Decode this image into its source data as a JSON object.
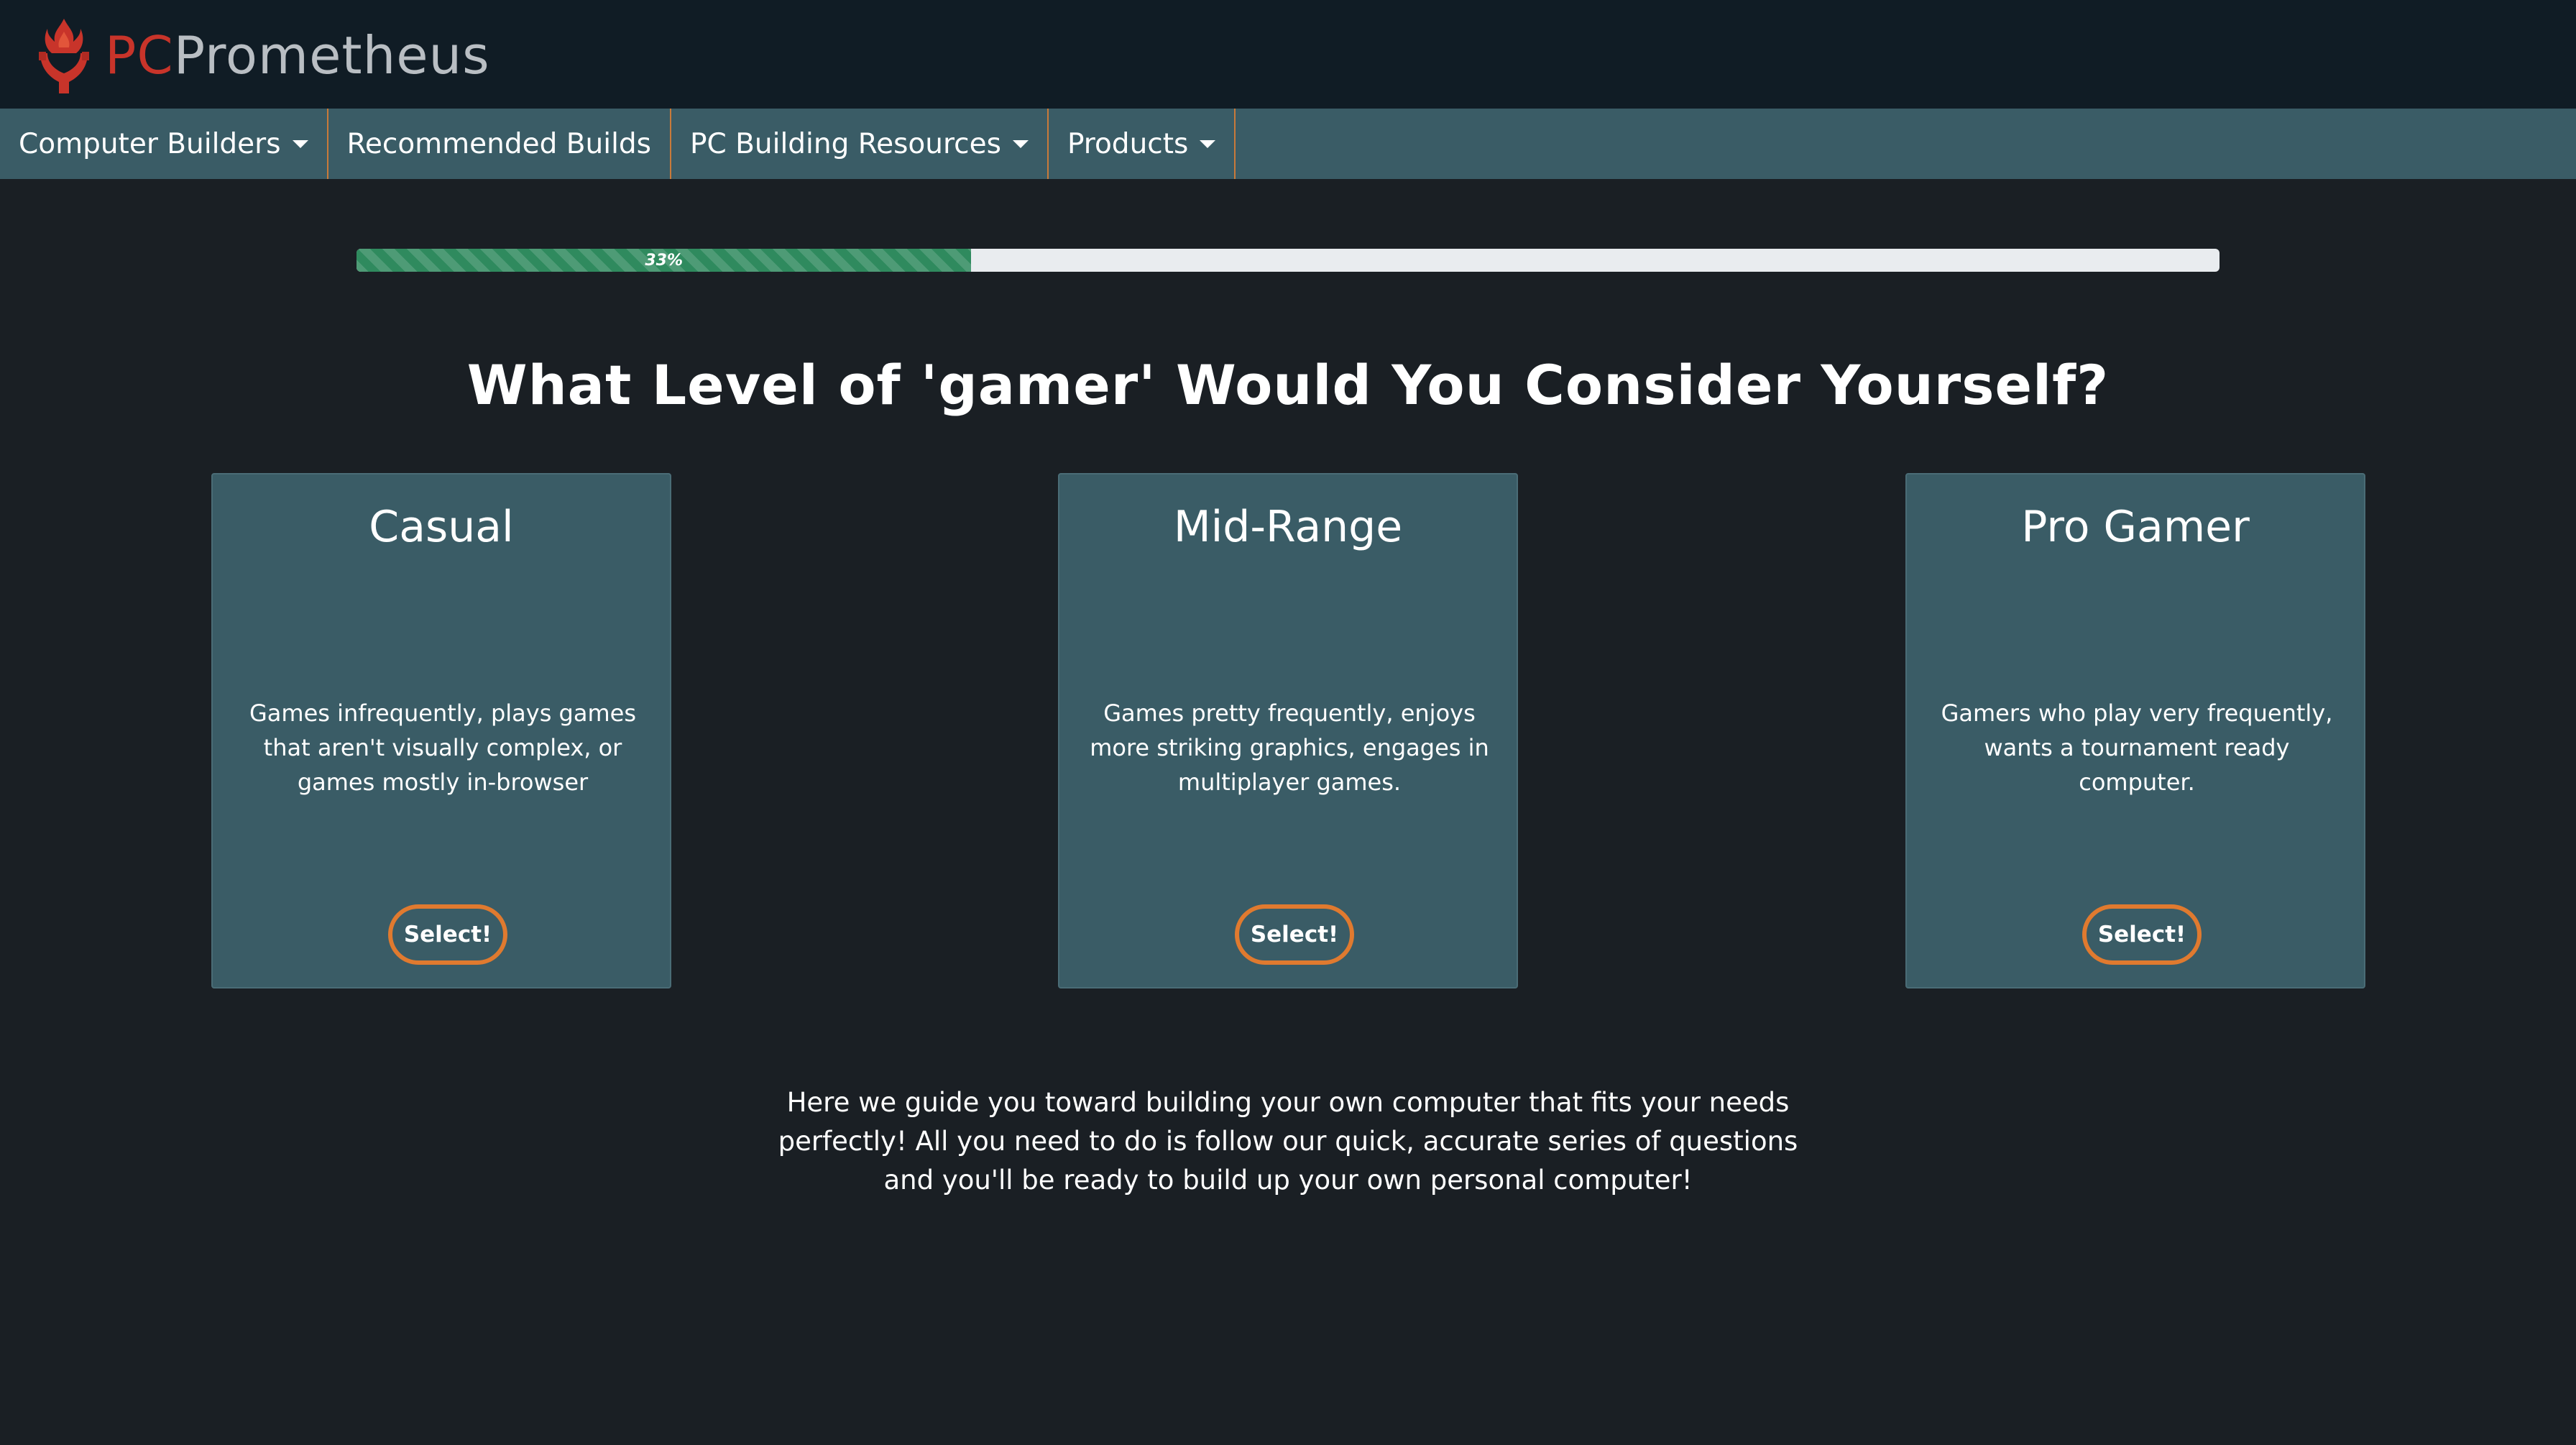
{
  "header": {
    "logo_pc": "PC",
    "logo_name": "Prometheus",
    "logo_icon": "flame-hands-icon"
  },
  "nav": {
    "items": [
      {
        "label": "Computer Builders",
        "has_dropdown": true
      },
      {
        "label": "Recommended Builds",
        "has_dropdown": false
      },
      {
        "label": "PC Building Resources",
        "has_dropdown": true
      },
      {
        "label": "Products",
        "has_dropdown": true
      }
    ]
  },
  "progress": {
    "value": 0.33,
    "label": "33%"
  },
  "question": {
    "title": "What Level of 'gamer' Would You Consider Yourself?"
  },
  "options": [
    {
      "title": "Casual",
      "description": "Games infrequently, plays games that aren't visually complex, or games mostly in-browser",
      "button": "Select!"
    },
    {
      "title": "Mid-Range",
      "description": "Games pretty frequently, enjoys more striking graphics, engages in multiplayer games.",
      "button": "Select!"
    },
    {
      "title": "Pro Gamer",
      "description": "Gamers who play very frequently, wants a tournament ready computer.",
      "button": "Select!"
    }
  ],
  "intro": {
    "text": "Here we guide you toward building your own computer that fits your needs perfectly! All you need to do is follow our quick, accurate series of questions and you'll be ready to build up your own personal computer!"
  },
  "colors": {
    "header_bg": "#101c25",
    "nav_bg": "#3a5c66",
    "page_bg": "#1a1f24",
    "card_bg": "#3a5c66",
    "accent": "#e07a2f",
    "progress_fill": "#2f8a5e",
    "logo_red": "#c8342a"
  }
}
